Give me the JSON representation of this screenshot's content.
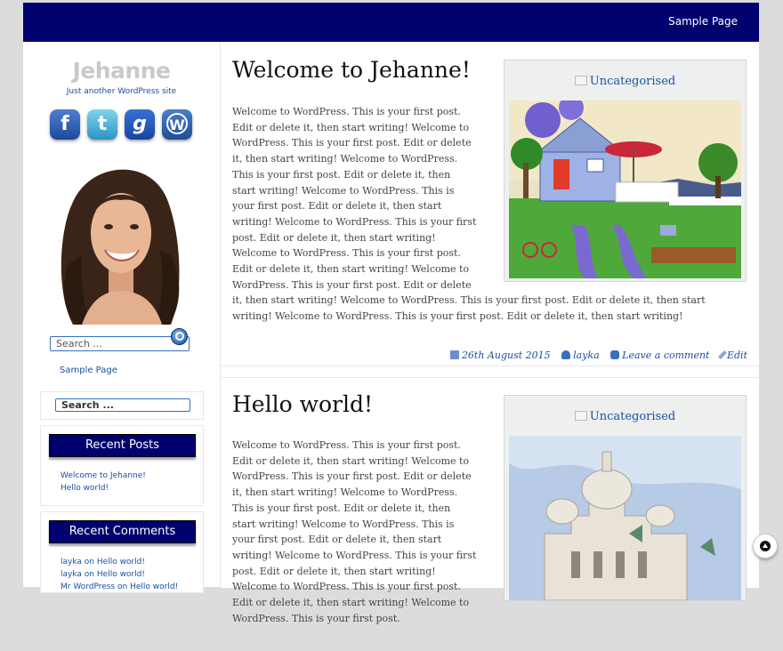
{
  "header": {
    "nav_link": "Sample Page"
  },
  "site": {
    "title": "Jehanne",
    "tagline": "Just another WordPress site"
  },
  "social": {
    "facebook": "f",
    "twitter": "t",
    "google": "g",
    "wordpress": "W"
  },
  "sidebar": {
    "search_placeholder": "Search ...",
    "sample_page": "Sample Page",
    "search_widget_placeholder": "Search ...",
    "recent_posts_title": "Recent Posts",
    "recent_posts": [
      "Welcome to Jehanne!",
      "Hello world!"
    ],
    "recent_comments_title": "Recent Comments",
    "recent_comments": [
      {
        "author": "layka",
        "on": "on",
        "post": "Hello world!"
      },
      {
        "author": "layka",
        "on": "on",
        "post": "Hello world!"
      },
      {
        "author": "Mr WordPress",
        "on": "on",
        "post": "Hello world!"
      }
    ]
  },
  "posts": [
    {
      "title": "Welcome to Jehanne!",
      "body": "Welcome to WordPress. This is your first post. Edit or delete it, then start writing! Welcome to WordPress. This is your first post. Edit or delete it, then start writing!  Welcome to WordPress. This is your first post. Edit or delete it, then start writing! Welcome to WordPress. This is your first post. Edit or delete it, then start writing! Welcome to WordPress. This is your first post. Edit or delete it, then start writing! Welcome to WordPress. This is your first post. Edit or delete it, then start writing! Welcome to WordPress. This is your first post. Edit or delete it, then start writing! Welcome to WordPress. This is your first post. Edit or delete it, then start writing! Welcome to WordPress. This is your first post. Edit or delete it, then start writing!",
      "category": "Uncategorised",
      "date": "26th August 2015",
      "author": "layka",
      "comments": "Leave a comment",
      "edit": "Edit"
    },
    {
      "title": "Hello world!",
      "body": "Welcome to WordPress. This is your first post. Edit or delete it, then start writing! Welcome to WordPress. This is your first post. Edit or delete it, then start writing!  Welcome to WordPress. This is your first post. Edit or delete it, then start writing! Welcome to WordPress. This is your first post. Edit or delete it, then start writing! Welcome to WordPress. This is your first post. Edit or delete it, then start writing! Welcome to WordPress. This is your first post. Edit or delete it, then start writing! Welcome to WordPress. This is your first post.",
      "category": "Uncategorised"
    }
  ],
  "colors": {
    "header_bg": "#00006e",
    "link": "#1a4fa0",
    "title_grey": "#c9c9c9"
  }
}
